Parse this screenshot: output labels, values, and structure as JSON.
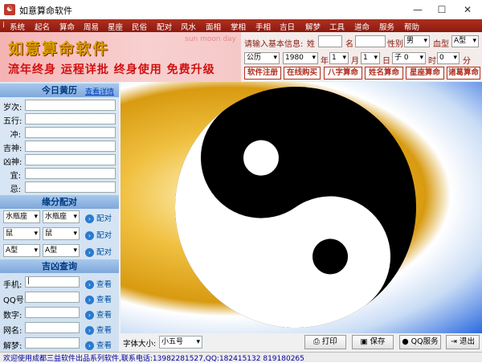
{
  "window": {
    "title": "如意算命软件",
    "minimize": "—",
    "maximize": "☐",
    "close": "✕"
  },
  "menu": [
    "系统",
    "起名",
    "算命",
    "周易",
    "星座",
    "民俗",
    "配对",
    "风水",
    "面相",
    "掌相",
    "手相",
    "吉日",
    "解梦",
    "工具",
    "道命",
    "服务",
    "帮助"
  ],
  "banner": {
    "title": "如意算命软件",
    "subtitle": "流年终身 运程详批  终身使用  免费升级",
    "deco": "sun  moon  day"
  },
  "info": {
    "prompt": "请输入基本信息:",
    "surname_label": "姓",
    "surname_value": "",
    "name_label": "名",
    "name_value": "",
    "gender_label": "性别",
    "gender_value": "男",
    "blood_label": "血型",
    "blood_value": "A型",
    "calendar_value": "公历",
    "year_value": "1980",
    "year_label": "年",
    "month_value": "1",
    "month_label": "月",
    "day_value": "1",
    "day_label": "日",
    "hour_value": "子 0",
    "hour_label": "时",
    "minute_value": "0",
    "minute_label": "分"
  },
  "action_buttons": [
    "软件注册",
    "在线购买",
    "八字算命",
    "姓名算命",
    "星座算命",
    "诸葛算命"
  ],
  "almanac": {
    "header": "今日黄历",
    "detail_link": "查看详情",
    "rows": [
      {
        "label": "岁次:",
        "value": ""
      },
      {
        "label": "五行:",
        "value": ""
      },
      {
        "label": "冲:",
        "value": ""
      },
      {
        "label": "吉神:",
        "value": ""
      },
      {
        "label": "凶神:",
        "value": ""
      },
      {
        "label": "宜:",
        "value": ""
      },
      {
        "label": "忌:",
        "value": ""
      }
    ]
  },
  "match": {
    "header": "缘分配对",
    "rows": [
      {
        "a": "水瓶座",
        "b": "水瓶座",
        "btn": "配对"
      },
      {
        "a": "鼠",
        "b": "鼠",
        "btn": "配对"
      },
      {
        "a": "A型",
        "b": "A型",
        "btn": "配对"
      }
    ]
  },
  "lookup": {
    "header": "吉凶查询",
    "rows": [
      {
        "label": "手机:",
        "value": "|",
        "btn": "查看"
      },
      {
        "label": "QQ号:",
        "value": "",
        "btn": "查看"
      },
      {
        "label": "数字:",
        "value": "",
        "btn": "查看"
      },
      {
        "label": "网名:",
        "value": "",
        "btn": "查看"
      },
      {
        "label": "解梦:",
        "value": "",
        "btn": "查看"
      }
    ]
  },
  "toolbar": {
    "font_label": "字体大小:",
    "font_value": "小五号",
    "print": "打印",
    "save": "保存",
    "qq": "QQ服务",
    "exit": "退出"
  },
  "status": "欢迎使用成都三益软件出品系列软件,联系电话:13982281527,QQ:182415132  819180265",
  "colors": {
    "menu_bg": "#a02818",
    "accent": "#b03020",
    "panel": "#cfe0f2"
  }
}
